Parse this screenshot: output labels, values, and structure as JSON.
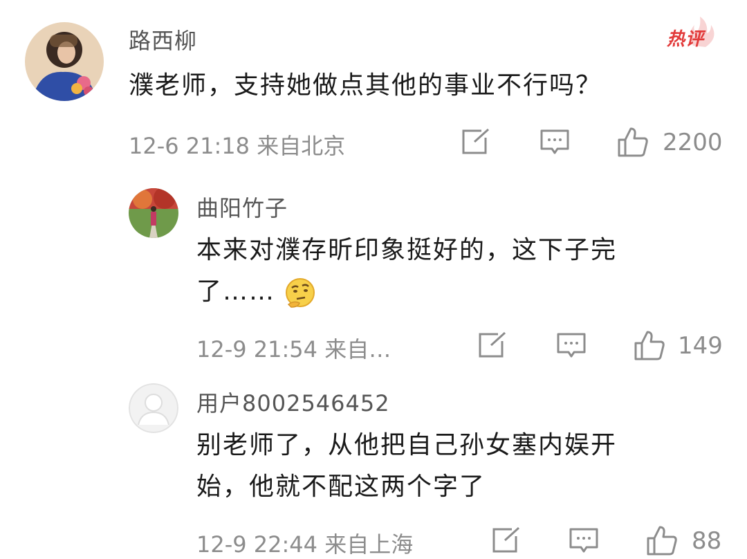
{
  "comments": [
    {
      "username": "路西柳",
      "badge": "热评",
      "text": "濮老师，支持她做点其他的事业不行吗？",
      "meta": "12-6 21:18 来自北京",
      "likes": "2200",
      "icons": [
        "edit-icon",
        "comment-icon",
        "thumbs-up-icon"
      ]
    },
    {
      "username": "曲阳竹子",
      "text_line1": "本来对濮存昕印象挺好的，这下子完",
      "text_line2": "了……",
      "emoji": "thinking-face-emoji",
      "meta": "12-9 21:54 来自…",
      "likes": "149"
    },
    {
      "username": "用户8002546452",
      "text_line1": "别老师了，从他把自己孙女塞内娱开",
      "text_line2": "始，他就不配这两个字了",
      "meta": "12-9 22:44 来自上海",
      "likes": "88"
    }
  ],
  "colors": {
    "accent_red": "#e23a3a",
    "meta_gray": "#8c8c8c",
    "name_gray": "#555555",
    "text": "#1a1a1a"
  }
}
